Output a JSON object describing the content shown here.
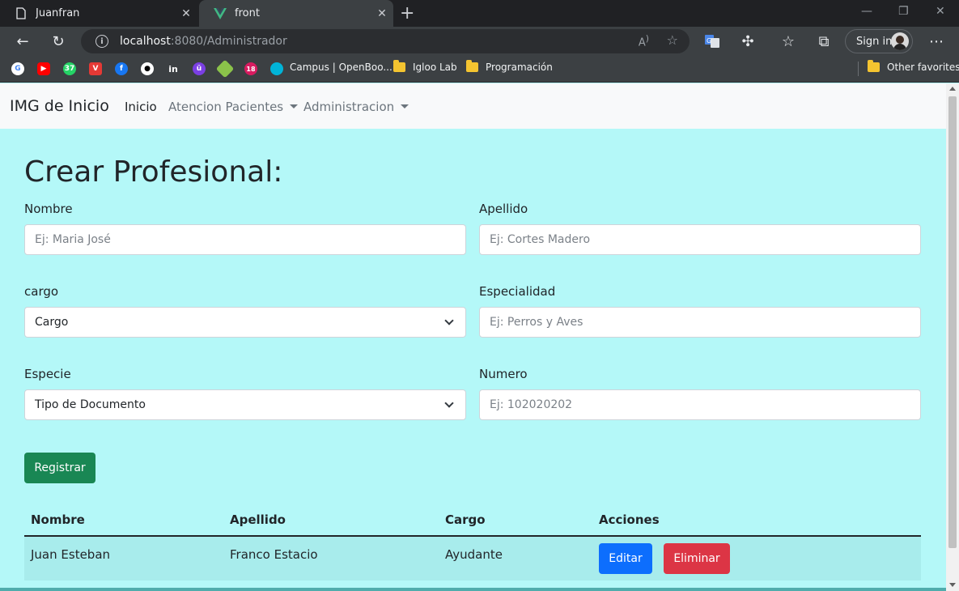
{
  "browser": {
    "tabs": [
      {
        "title": "Juanfran"
      },
      {
        "title": "front"
      }
    ],
    "url_host": "localhost",
    "url_rest": ":8080/Administrador",
    "signin_label": "Sign in",
    "bookmarks": {
      "items": [
        {
          "label": "Campus | OpenBoo..."
        },
        {
          "label": "Igloo Lab"
        },
        {
          "label": "Programación"
        }
      ],
      "other_label": "Other favorites",
      "badges": {
        "whatsapp": "37",
        "notif": "18"
      }
    }
  },
  "navbar": {
    "brand": "IMG de Inicio",
    "links": [
      {
        "label": "Inicio"
      },
      {
        "label": "Atencion Pacientes"
      },
      {
        "label": "Administracion"
      }
    ]
  },
  "form": {
    "title": "Crear Profesional:",
    "nombre": {
      "label": "Nombre",
      "placeholder": "Ej: Maria José"
    },
    "apellido": {
      "label": "Apellido",
      "placeholder": "Ej: Cortes Madero"
    },
    "cargo": {
      "label": "cargo",
      "selected": "Cargo"
    },
    "especialidad": {
      "label": "Especialidad",
      "placeholder": "Ej: Perros y Aves"
    },
    "especie": {
      "label": "Especie",
      "selected": "Tipo de Documento"
    },
    "numero": {
      "label": "Numero",
      "placeholder": "Ej: 102020202"
    },
    "submit_label": "Registrar"
  },
  "table": {
    "headers": [
      "Nombre",
      "Apellido",
      "Cargo",
      "Acciones"
    ],
    "rows": [
      {
        "nombre": "Juan Esteban",
        "apellido": "Franco Estacio",
        "cargo": "Ayudante",
        "edit_label": "Editar",
        "delete_label": "Eliminar"
      }
    ]
  },
  "colors": {
    "page_bg": "#b4f8f8",
    "primary": "#0d6efd",
    "success": "#198754",
    "danger": "#dc3545"
  }
}
